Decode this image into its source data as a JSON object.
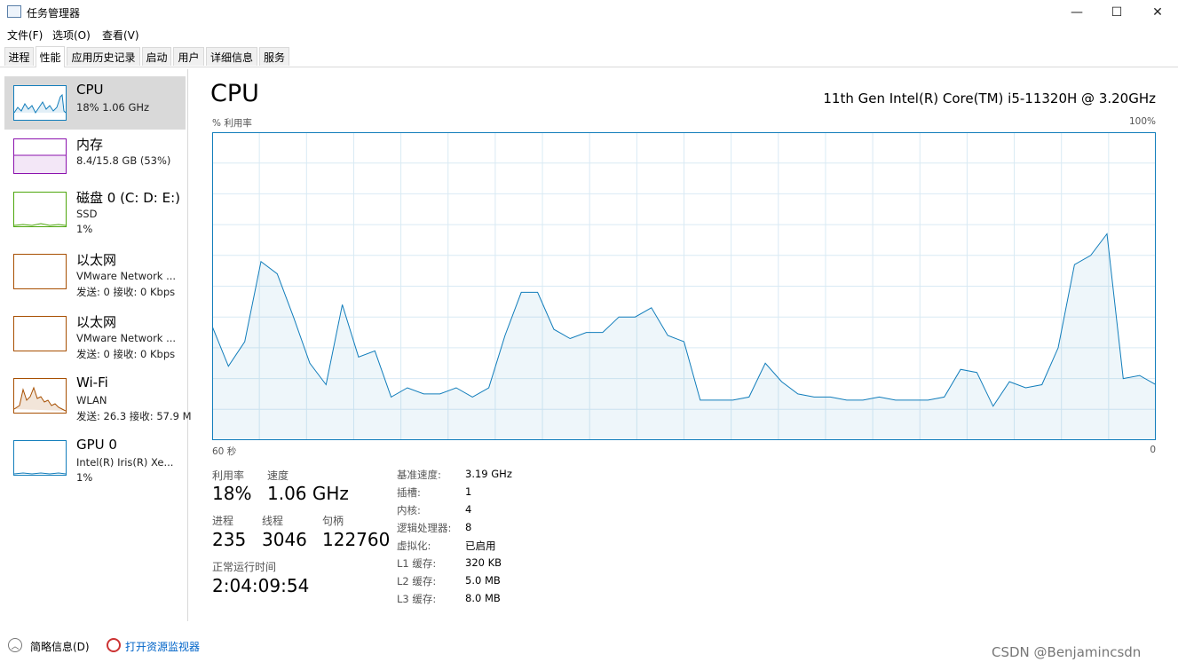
{
  "window": {
    "title": "任务管理器",
    "controls": {
      "minimize": "—",
      "maximize": "☐",
      "close": "✕"
    }
  },
  "menu": [
    "文件(F)",
    "选项(O)",
    "查看(V)"
  ],
  "tabs": [
    "进程",
    "性能",
    "应用历史记录",
    "启动",
    "用户",
    "详细信息",
    "服务"
  ],
  "active_tab": "性能",
  "resources": [
    {
      "title": "CPU",
      "lines": [
        "18% 1.06 GHz"
      ],
      "color": "#117dbb"
    },
    {
      "title": "内存",
      "lines": [
        "8.4/15.8 GB (53%)"
      ],
      "color": "#8b12ae"
    },
    {
      "title": "磁盘 0 (C: D: E:)",
      "lines": [
        "SSD",
        "1%"
      ],
      "color": "#4da60c"
    },
    {
      "title": "以太网",
      "lines": [
        "VMware Network ...",
        "发送: 0 接收: 0 Kbps"
      ],
      "color": "#a74f01"
    },
    {
      "title": "以太网",
      "lines": [
        "VMware Network ...",
        "发送: 0 接收: 0 Kbps"
      ],
      "color": "#a74f01"
    },
    {
      "title": "Wi-Fi",
      "lines": [
        "WLAN",
        "发送: 26.3 接收: 57.9 M"
      ],
      "color": "#a74f01"
    },
    {
      "title": "GPU 0",
      "lines": [
        "Intel(R) Iris(R) Xe...",
        "1%"
      ],
      "color": "#117dbb"
    }
  ],
  "main": {
    "title": "CPU",
    "model": "11th Gen Intel(R) Core(TM) i5-11320H @ 3.20GHz",
    "util_label": "% 利用率",
    "util_max": "100%",
    "axis_left": "60 秒",
    "axis_right": "0",
    "stats": {
      "util_label": "利用率",
      "util_value": "18%",
      "speed_label": "速度",
      "speed_value": "1.06 GHz",
      "proc_label": "进程",
      "proc_value": "235",
      "thread_label": "线程",
      "thread_value": "3046",
      "handle_label": "句柄",
      "handle_value": "122760",
      "uptime_label": "正常运行时间",
      "uptime_value": "2:04:09:54"
    },
    "details": [
      {
        "label": "基准速度:",
        "value": "3.19 GHz"
      },
      {
        "label": "插槽:",
        "value": "1"
      },
      {
        "label": "内核:",
        "value": "4"
      },
      {
        "label": "逻辑处理器:",
        "value": "8"
      },
      {
        "label": "虚拟化:",
        "value": "已启用"
      },
      {
        "label": "L1 缓存:",
        "value": "320 KB"
      },
      {
        "label": "L2 缓存:",
        "value": "5.0 MB"
      },
      {
        "label": "L3 缓存:",
        "value": "8.0 MB"
      }
    ]
  },
  "chart_data": {
    "type": "area",
    "x_range": [
      60,
      0
    ],
    "ylim": [
      0,
      100
    ],
    "grid": true,
    "color": "#117dbb",
    "series": [
      {
        "values": [
          37,
          24,
          32,
          58,
          54,
          40,
          25,
          18,
          44,
          27,
          29,
          14,
          17,
          15,
          15,
          17,
          14,
          17,
          34,
          48,
          48,
          36,
          33,
          35,
          35,
          40,
          40,
          43,
          34,
          32,
          13,
          13,
          13,
          14,
          25,
          19,
          15,
          14,
          14,
          13,
          13,
          14,
          13,
          13,
          13,
          14,
          23,
          22,
          11,
          19,
          17,
          18,
          30,
          57,
          60,
          67,
          20,
          21,
          18
        ]
      }
    ]
  },
  "footer": {
    "fewer_details": "简略信息(D)",
    "open_monitor": "打开资源监视器"
  },
  "watermark": "CSDN @Benjamincsdn"
}
